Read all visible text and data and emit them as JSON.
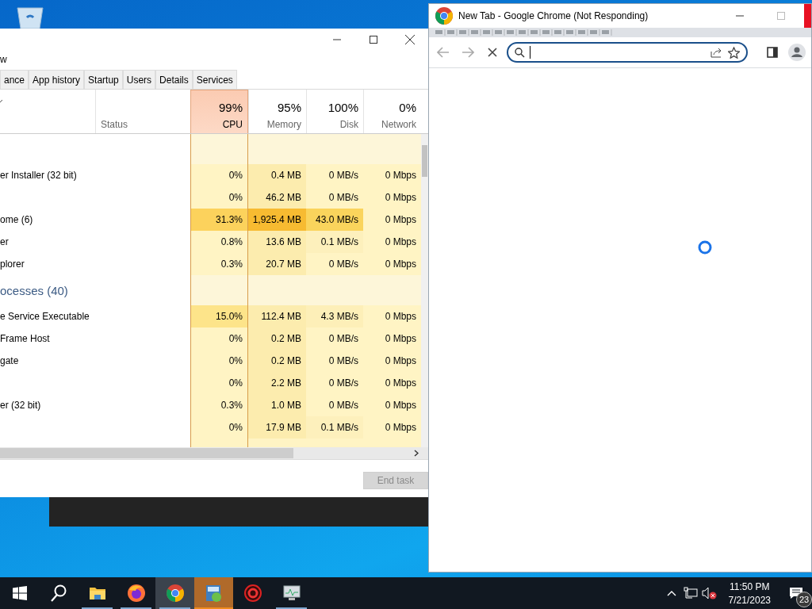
{
  "task_manager": {
    "menu": [
      "w"
    ],
    "tabs": [
      {
        "label": "ance",
        "selected": false
      },
      {
        "label": "App history",
        "selected": false
      },
      {
        "label": "Startup",
        "selected": false
      },
      {
        "label": "Users",
        "selected": false
      },
      {
        "label": "Details",
        "selected": false
      },
      {
        "label": "Services",
        "selected": false
      }
    ],
    "status_column": "Status",
    "metric_columns": [
      {
        "percent": "99%",
        "label": "CPU",
        "highlighted": true
      },
      {
        "percent": "95%",
        "label": "Memory",
        "highlighted": false
      },
      {
        "percent": "100%",
        "label": "Disk",
        "highlighted": false
      },
      {
        "percent": "0%",
        "label": "Network",
        "highlighted": false
      }
    ],
    "rows": [
      {
        "kind": "group"
      },
      {
        "kind": "process",
        "name": "er Installer (32 bit)",
        "cells": [
          {
            "text": "0%",
            "color": "#fff4c4"
          },
          {
            "text": "0.4 MB",
            "color": "#fcecae"
          },
          {
            "text": "0 MB/s",
            "color": "#fff4c4"
          },
          {
            "text": "0 Mbps",
            "color": "#fff4c4"
          }
        ]
      },
      {
        "kind": "process",
        "cells": [
          {
            "text": "0%",
            "color": "#fff4c4"
          },
          {
            "text": "46.2 MB",
            "color": "#fcecae"
          },
          {
            "text": "0 MB/s",
            "color": "#fff4c4"
          },
          {
            "text": "0 Mbps",
            "color": "#fff4c4"
          }
        ]
      },
      {
        "kind": "process",
        "name": "ome (6)",
        "cells": [
          {
            "text": "31.3%",
            "color": "#fcd25c"
          },
          {
            "text": "1,925.4 MB",
            "color": "#f7bb31"
          },
          {
            "text": "43.0 MB/s",
            "color": "#fad45c"
          },
          {
            "text": "0 Mbps",
            "color": "#fff4c4"
          }
        ]
      },
      {
        "kind": "process",
        "name": "er",
        "cells": [
          {
            "text": "0.8%",
            "color": "#fff4c4"
          },
          {
            "text": "13.6 MB",
            "color": "#fcecae"
          },
          {
            "text": "0.1 MB/s",
            "color": "#fdf0bc"
          },
          {
            "text": "0 Mbps",
            "color": "#fff4c4"
          }
        ]
      },
      {
        "kind": "process",
        "name": "plorer",
        "cells": [
          {
            "text": "0.3%",
            "color": "#fff4c4"
          },
          {
            "text": "20.7 MB",
            "color": "#fcecae"
          },
          {
            "text": "0 MB/s",
            "color": "#fff4c4"
          },
          {
            "text": "0 Mbps",
            "color": "#fff4c4"
          }
        ]
      },
      {
        "kind": "group",
        "name": "ocesses (40)"
      },
      {
        "kind": "process",
        "name": "e Service Executable",
        "cells": [
          {
            "text": "15.0%",
            "color": "#fde48a"
          },
          {
            "text": "112.4 MB",
            "color": "#fcecae"
          },
          {
            "text": "4.3 MB/s",
            "color": "#fdefb8"
          },
          {
            "text": "0 Mbps",
            "color": "#fff4c4"
          }
        ]
      },
      {
        "kind": "process",
        "name": "Frame Host",
        "cells": [
          {
            "text": "0%",
            "color": "#fff4c4"
          },
          {
            "text": "0.2 MB",
            "color": "#fcecae"
          },
          {
            "text": "0 MB/s",
            "color": "#fff4c4"
          },
          {
            "text": "0 Mbps",
            "color": "#fff4c4"
          }
        ]
      },
      {
        "kind": "process",
        "name": "gate",
        "cells": [
          {
            "text": "0%",
            "color": "#fff4c4"
          },
          {
            "text": "0.2 MB",
            "color": "#fcecae"
          },
          {
            "text": "0 MB/s",
            "color": "#fff4c4"
          },
          {
            "text": "0 Mbps",
            "color": "#fff4c4"
          }
        ]
      },
      {
        "kind": "process",
        "cells": [
          {
            "text": "0%",
            "color": "#fff4c4"
          },
          {
            "text": "2.2 MB",
            "color": "#fcecae"
          },
          {
            "text": "0 MB/s",
            "color": "#fff4c4"
          },
          {
            "text": "0 Mbps",
            "color": "#fff4c4"
          }
        ]
      },
      {
        "kind": "process",
        "name": "er (32 bit)",
        "cells": [
          {
            "text": "0.3%",
            "color": "#fff4c4"
          },
          {
            "text": "1.0 MB",
            "color": "#fcecae"
          },
          {
            "text": "0 MB/s",
            "color": "#fff4c4"
          },
          {
            "text": "0 Mbps",
            "color": "#fff4c4"
          }
        ]
      },
      {
        "kind": "process",
        "cells": [
          {
            "text": "0%",
            "color": "#fff4c4"
          },
          {
            "text": "17.9 MB",
            "color": "#fcecae"
          },
          {
            "text": "0.1 MB/s",
            "color": "#fdf0bc"
          },
          {
            "text": "0 Mbps",
            "color": "#fff4c4"
          }
        ]
      }
    ],
    "end_task": {
      "label": "End task",
      "disabled": true
    }
  },
  "chrome": {
    "title": "New Tab - Google Chrome (Not Responding)",
    "loading": true
  },
  "taskbar": {
    "apps": [
      {
        "kind": "folder",
        "running": true,
        "selected": false,
        "flashing": false
      },
      {
        "kind": "firefox",
        "running": true,
        "selected": false,
        "flashing": false
      },
      {
        "kind": "chrome",
        "running": true,
        "selected": true,
        "flashing": false
      },
      {
        "kind": "installer",
        "running": true,
        "selected": false,
        "flashing": true
      },
      {
        "kind": "red-gear",
        "running": false,
        "selected": false,
        "flashing": false
      },
      {
        "kind": "monitor",
        "running": true,
        "selected": false,
        "flashing": false
      }
    ],
    "volume_muted": true,
    "clock": {
      "time": "11:50 PM",
      "date": "7/21/2023"
    },
    "notifications": "23"
  }
}
